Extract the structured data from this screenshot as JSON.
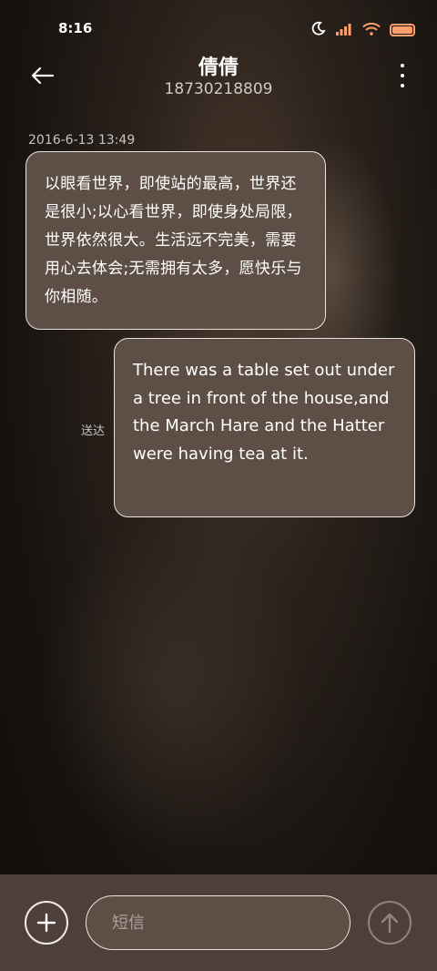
{
  "status_bar": {
    "time": "8:16",
    "icons": [
      "moon-icon",
      "signal-icon",
      "wifi-icon",
      "battery-icon"
    ],
    "battery_color": "#ff9f6b"
  },
  "header": {
    "contact_name": "倩倩",
    "phone_number": "18730218809",
    "back_icon": "back-arrow-icon",
    "menu_icon": "more-vertical-icon"
  },
  "conversation": {
    "timestamp": "2016-6-13 13:49",
    "messages": [
      {
        "direction": "incoming",
        "text": "以眼看世界，即使站的最高，世界还是很小;以心看世界，即使身处局限，世界依然很大。生活远不完美，需要用心去体会;无需拥有太多，愿快乐与你相随。"
      },
      {
        "direction": "outgoing",
        "text": "There was a table set out under a tree in front of the house,and the March Hare and the Hatter were having tea at it.",
        "status": "送达"
      }
    ]
  },
  "composer": {
    "add_icon": "plus-icon",
    "placeholder": "短信",
    "value": "",
    "send_icon": "send-arrow-up-icon"
  },
  "colors": {
    "bubble_fill": "#5d4f45",
    "bubble_border": "#e9e4df",
    "bottom_bar": "#4e4038"
  }
}
